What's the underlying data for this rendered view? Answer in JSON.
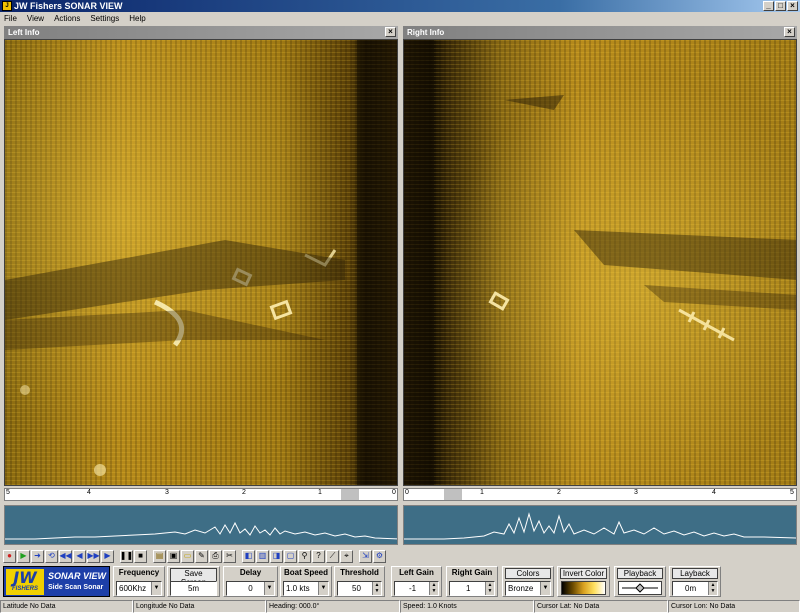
{
  "window": {
    "title": "JW Fishers SONAR VIEW",
    "controls": {
      "minimize": "_",
      "maximize": "□",
      "close": "×"
    }
  },
  "menu": {
    "items": [
      "File",
      "View",
      "Actions",
      "Settings",
      "Help"
    ]
  },
  "panes": {
    "left": {
      "title": "Left Info",
      "close": "×"
    },
    "right": {
      "title": "Right Info",
      "close": "×"
    }
  },
  "rulers": {
    "left": {
      "ticks": [
        "5",
        "4",
        "3",
        "2",
        "1",
        "0"
      ]
    },
    "right": {
      "ticks": [
        "0",
        "1",
        "2",
        "3",
        "4",
        "5"
      ]
    }
  },
  "controls": {
    "frequency": {
      "label": "Frequency",
      "value": "600Khz"
    },
    "save_screen": {
      "label": "Save Screen",
      "value": "5m"
    },
    "delay": {
      "label": "Delay",
      "value": "0"
    },
    "boat_speed": {
      "label": "Boat Speed",
      "value": "1.0 kts"
    },
    "threshold": {
      "label": "Threshold",
      "value": "50"
    },
    "left_gain": {
      "label": "Left Gain",
      "value": "-1"
    },
    "right_gain": {
      "label": "Right Gain",
      "value": "1"
    },
    "colors": {
      "label": "Colors",
      "value": "Bronze"
    },
    "invert_color": {
      "label": "Invert Color"
    },
    "playback": {
      "label": "Playback"
    },
    "layback": {
      "label": "Layback",
      "value": "0m"
    }
  },
  "logo": {
    "badge": "JW",
    "badge_sub": "FISHERS",
    "name": "SONAR VIEW",
    "subtitle": "Side Scan Sonar"
  },
  "status": [
    "Latitude No Data",
    "Longitude No Data",
    "Heading: 000.0°",
    "Speed: 1.0 Knots",
    "Cursor Lat: No Data",
    "Cursor Lon: No Data"
  ],
  "colors": {
    "accent": "#0a246a",
    "sonar_bronze": "#b68a1a",
    "wave_bg": "#3e6e86"
  }
}
